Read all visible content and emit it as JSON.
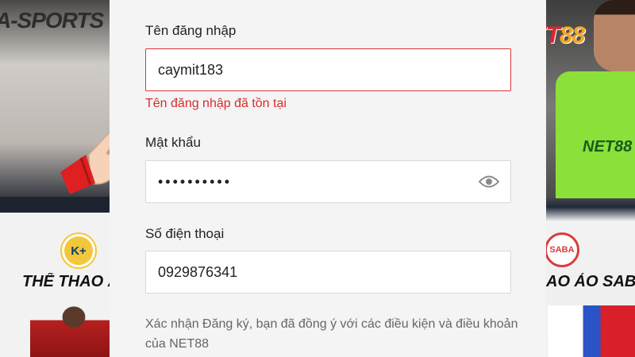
{
  "background": {
    "left_heading": "A-SPORTS",
    "left_caption": "THỂ THAO ẢO",
    "left_badge": "K+",
    "right_caption": "AO ẢO SABA",
    "right_badge": "SABA",
    "jersey_text": "NET88"
  },
  "brand": {
    "logo_prefix": "NET",
    "logo_suffix": "88",
    "colors": {
      "primary": "#e0262c",
      "accent": "#f5a623"
    }
  },
  "form": {
    "username": {
      "label": "Tên đăng nhập",
      "value": "caymit183",
      "error": "Tên đăng nhập đã tồn tại"
    },
    "password": {
      "label": "Mật khẩu",
      "value": "••••••••••",
      "toggle_icon": "eye-icon"
    },
    "phone": {
      "label": "Số điện thoại",
      "value": "0929876341"
    },
    "terms": "Xác nhận Đăng ký, bạn đã đồng ý với các điều kiện và điều khoản của NET88"
  }
}
